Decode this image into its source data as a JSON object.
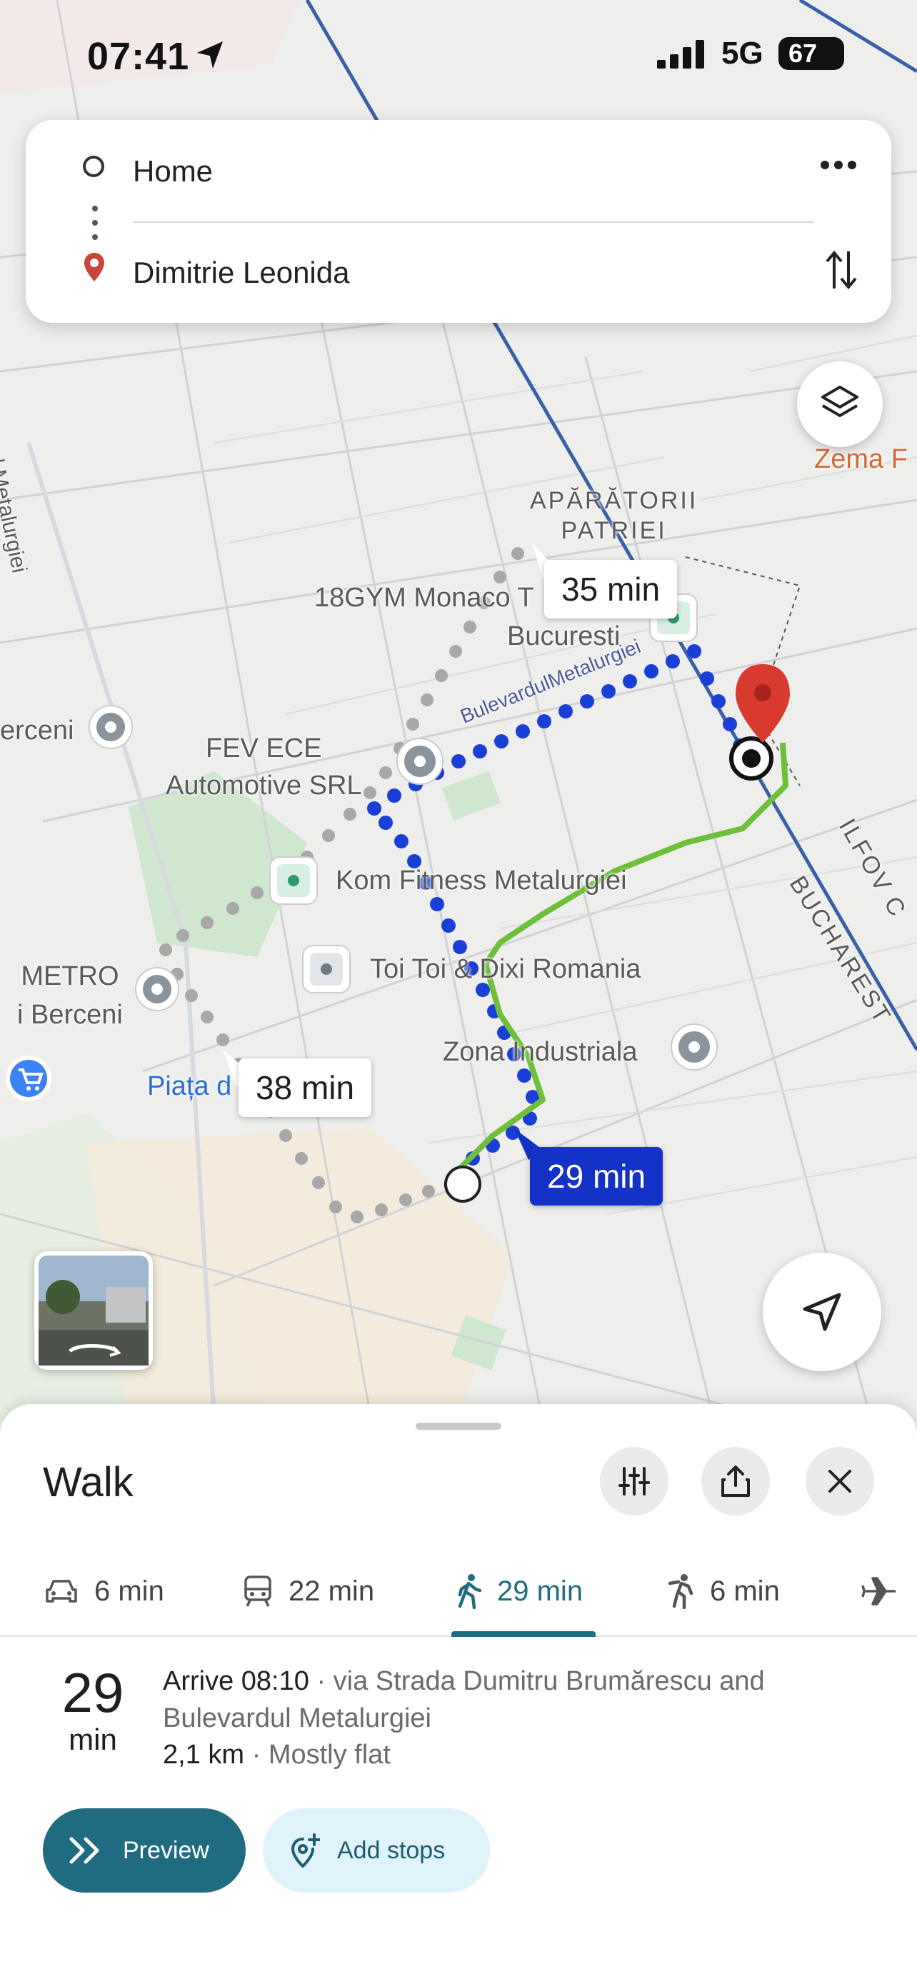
{
  "status": {
    "time": "07:41",
    "network": "5G",
    "battery": "67"
  },
  "route_card": {
    "origin": "Home",
    "destination": "Dimitrie Leonida"
  },
  "map": {
    "labels": {
      "aparatorii": "APĂRĂTORII\nPATRIEI",
      "gym": "18GYM Monaco T",
      "bucuresti": "Bucuresti",
      "zema": "Zema F",
      "berceni": "erceni",
      "fev": "FEV ECE\nAutomotive SRL",
      "bulevardul": "BulevardulMetalurgiei",
      "kom": "Kom Fitness Metalurgiei",
      "toi": "Toi Toi & Dixi Romania",
      "metro": "METRO\ni Berceni",
      "piata": "Piața d",
      "zona": "Zona Industriala",
      "ilfov": "ILFOV C",
      "bucharest": "BUCHAREST",
      "metalurgiei_side": "l Metalurgiei"
    },
    "route_times": {
      "alt1": "35 min",
      "alt2": "38 min",
      "selected": "29 min"
    },
    "colors": {
      "selected_route": "#1a3fd6",
      "alt_route": "#a4a4a4",
      "walk_line": "#6fbf3a",
      "destination_pin": "#d93a2f"
    }
  },
  "sheet": {
    "title": "Walk",
    "modes": [
      {
        "icon": "car-icon",
        "label": "6 min"
      },
      {
        "icon": "transit-icon",
        "label": "22 min"
      },
      {
        "icon": "walk-icon",
        "label": "29 min",
        "active": true
      },
      {
        "icon": "rideshare-icon",
        "label": "6 min"
      },
      {
        "icon": "flight-icon",
        "label": ""
      }
    ],
    "duration_value": "29",
    "duration_unit": "min",
    "arrive": "Arrive 08:10",
    "via": " · via Strada Dumitru Brumărescu and Bulevardul Metalurgiei",
    "distance": "2,1 km",
    "terrain": " · Mostly flat",
    "preview_label": "Preview",
    "add_stops_label": "Add stops"
  }
}
